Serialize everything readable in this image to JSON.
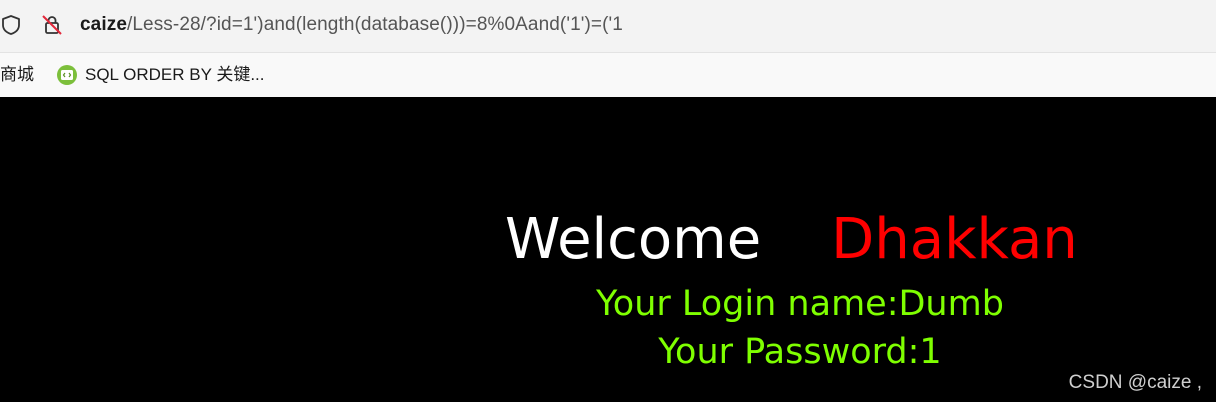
{
  "browser": {
    "url_host": "caize",
    "url_path": "/Less-28/?id=1')and(length(database()))=8%0Aand('1')=('1",
    "bookmarks": [
      {
        "label": "商城"
      },
      {
        "label": "SQL ORDER BY 关键...",
        "icon": "code-bookmark-icon"
      }
    ],
    "icons": [
      "shield-icon",
      "lock-slash-icon"
    ]
  },
  "page": {
    "welcome": "Welcome",
    "dhakkan": "Dhakkan",
    "login_name": "Your Login name:Dumb",
    "password": "Your Password:1",
    "colors": {
      "background": "#000000",
      "welcome": "#ffffff",
      "dhakkan": "#ff0000",
      "info": "#7fff00"
    }
  },
  "watermark": "CSDN @caize ,"
}
